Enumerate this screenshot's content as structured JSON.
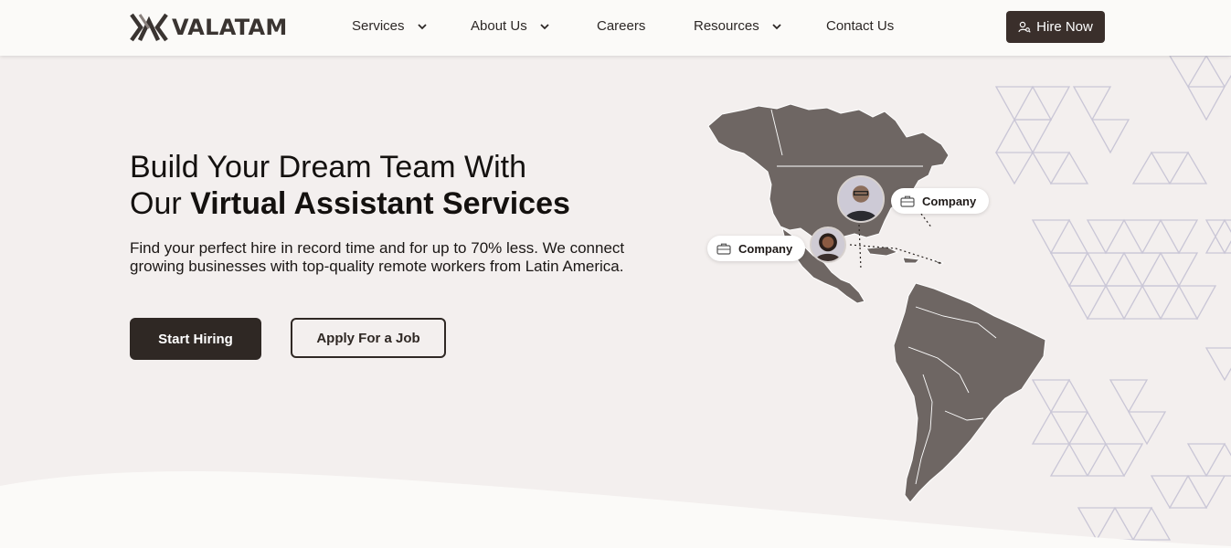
{
  "brand": {
    "name": "VALATAM"
  },
  "nav": {
    "items": [
      {
        "label": "Services",
        "has_dropdown": true
      },
      {
        "label": "About Us",
        "has_dropdown": true
      },
      {
        "label": "Careers",
        "has_dropdown": false
      },
      {
        "label": "Resources",
        "has_dropdown": true
      },
      {
        "label": "Contact Us",
        "has_dropdown": false
      }
    ],
    "cta_label": "Hire Now",
    "cta_icon": "user-search-icon"
  },
  "hero": {
    "title_line1": "Build Your Dream Team With",
    "title_line2_prefix": "Our ",
    "title_line2_strong": "Virtual Assistant Services",
    "description": "Find your perfect hire in record time and for up to 70% less. We connect growing businesses with top-quality remote workers from Latin America.",
    "primary_button": "Start Hiring",
    "secondary_button": "Apply For a Job"
  },
  "map": {
    "chips": [
      {
        "label": "Company",
        "icon": "briefcase-icon"
      },
      {
        "label": "Company",
        "icon": "briefcase-icon"
      }
    ]
  },
  "colors": {
    "background": "#f3efee",
    "header": "#fbfaf8",
    "primary": "#2f2824",
    "map": "#6e6663",
    "pattern": "#c9c6d6"
  }
}
